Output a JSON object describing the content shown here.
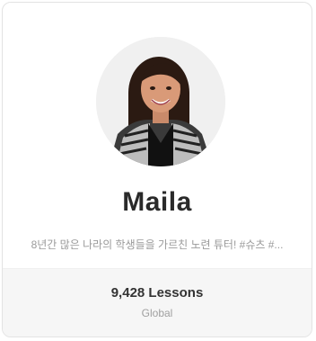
{
  "tutor": {
    "name": "Maila",
    "description": "8년간 많은 나라의 학생들을 가르친 노련 튜터! #슈츠 #...",
    "lessons": "9,428 Lessons",
    "region": "Global"
  },
  "colors": {
    "card_border": "#e3e3e3",
    "footer_bg": "#f6f6f6",
    "name": "#2a2a2a",
    "muted_text": "#9a9a9a"
  }
}
